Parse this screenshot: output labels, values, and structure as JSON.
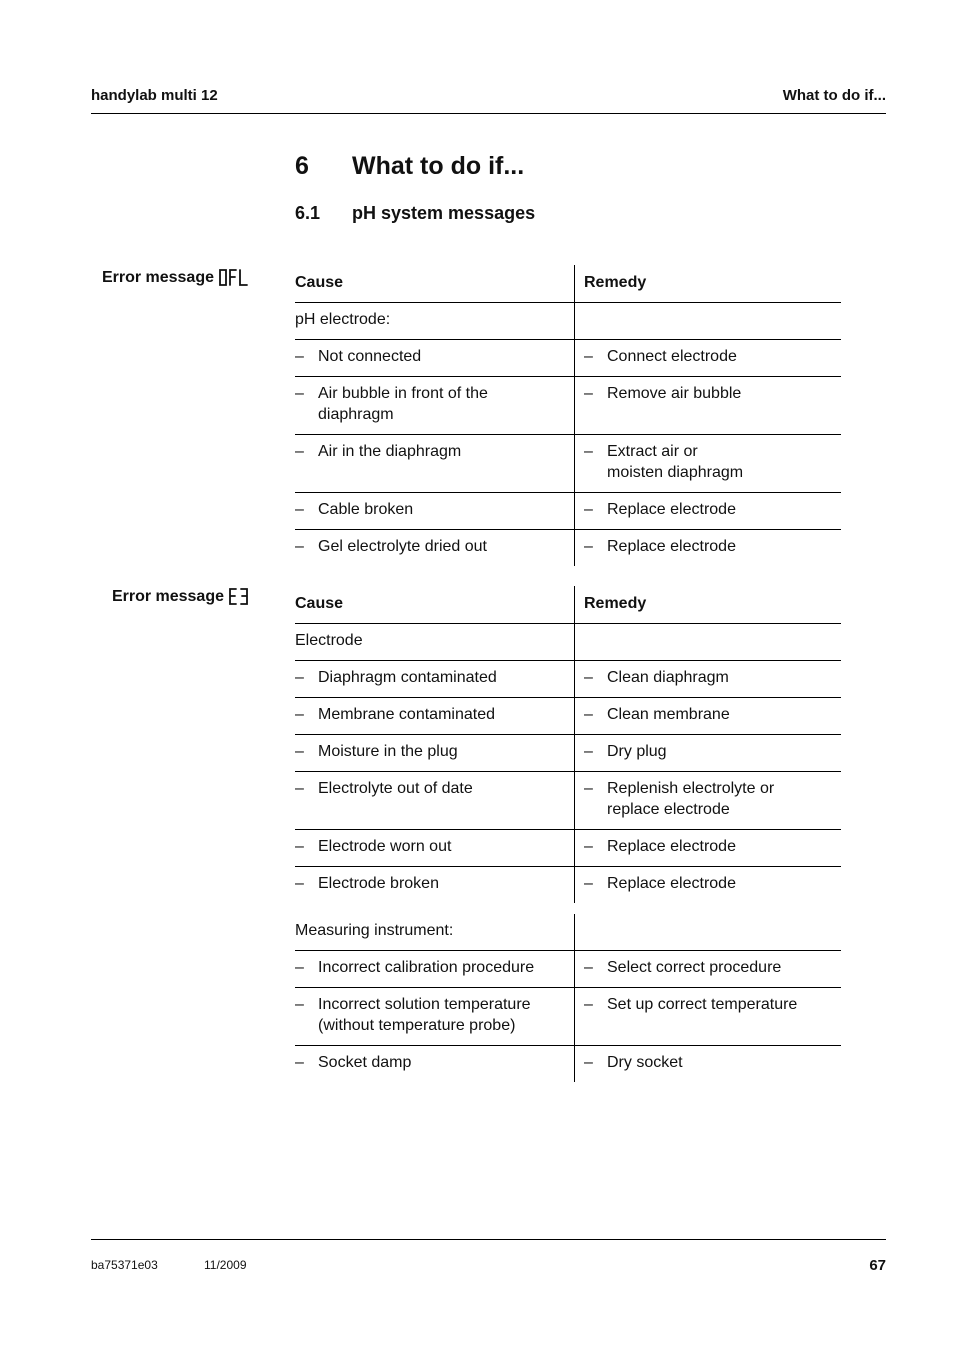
{
  "header": {
    "left": "handylab multi 12",
    "right": "What to do if..."
  },
  "chapter": {
    "number": "6",
    "title": "What to do if..."
  },
  "section": {
    "number": "6.1",
    "title": "pH system messages"
  },
  "tables": [
    {
      "label": "Error message",
      "display_code": "OFL",
      "header": {
        "cause": "Cause",
        "remedy": "Remedy"
      },
      "group_title": "pH electrode:",
      "rows": [
        {
          "cause": [
            "Not connected"
          ],
          "remedy": [
            "Connect electrode"
          ]
        },
        {
          "cause": [
            "Air bubble in front of the",
            "diaphragm"
          ],
          "remedy": [
            "Remove air bubble"
          ]
        },
        {
          "cause": [
            "Air in the diaphragm"
          ],
          "remedy": [
            "Extract air or",
            "moisten diaphragm"
          ]
        },
        {
          "cause": [
            "Cable broken"
          ],
          "remedy": [
            "Replace electrode"
          ]
        },
        {
          "cause": [
            "Gel electrolyte dried out"
          ],
          "remedy": [
            "Replace electrode"
          ]
        }
      ]
    },
    {
      "label": "Error message",
      "display_code": "E3",
      "header": {
        "cause": "Cause",
        "remedy": "Remedy"
      },
      "group_title": "Electrode",
      "rows": [
        {
          "cause": [
            "Diaphragm contaminated"
          ],
          "remedy": [
            "Clean diaphragm"
          ]
        },
        {
          "cause": [
            "Membrane contaminated"
          ],
          "remedy": [
            "Clean membrane"
          ]
        },
        {
          "cause": [
            "Moisture in the plug"
          ],
          "remedy": [
            "Dry plug"
          ]
        },
        {
          "cause": [
            "Electrolyte out of date"
          ],
          "remedy": [
            "Replenish electrolyte or",
            "replace electrode"
          ]
        },
        {
          "cause": [
            "Electrode worn out"
          ],
          "remedy": [
            "Replace electrode"
          ]
        },
        {
          "cause": [
            "Electrode broken"
          ],
          "remedy": [
            "Replace electrode"
          ]
        }
      ]
    },
    {
      "group_title": "Measuring instrument:",
      "rows": [
        {
          "cause": [
            "Incorrect calibration procedure"
          ],
          "remedy": [
            "Select correct procedure"
          ]
        },
        {
          "cause": [
            "Incorrect solution temperature",
            "(without temperature probe)"
          ],
          "remedy": [
            "Set up correct temperature"
          ]
        },
        {
          "cause": [
            "Socket damp"
          ],
          "remedy": [
            "Dry socket"
          ]
        }
      ]
    }
  ],
  "dash": "–",
  "footer": {
    "doc_id": "ba75371e03",
    "date": "11/2009",
    "page": "67"
  }
}
